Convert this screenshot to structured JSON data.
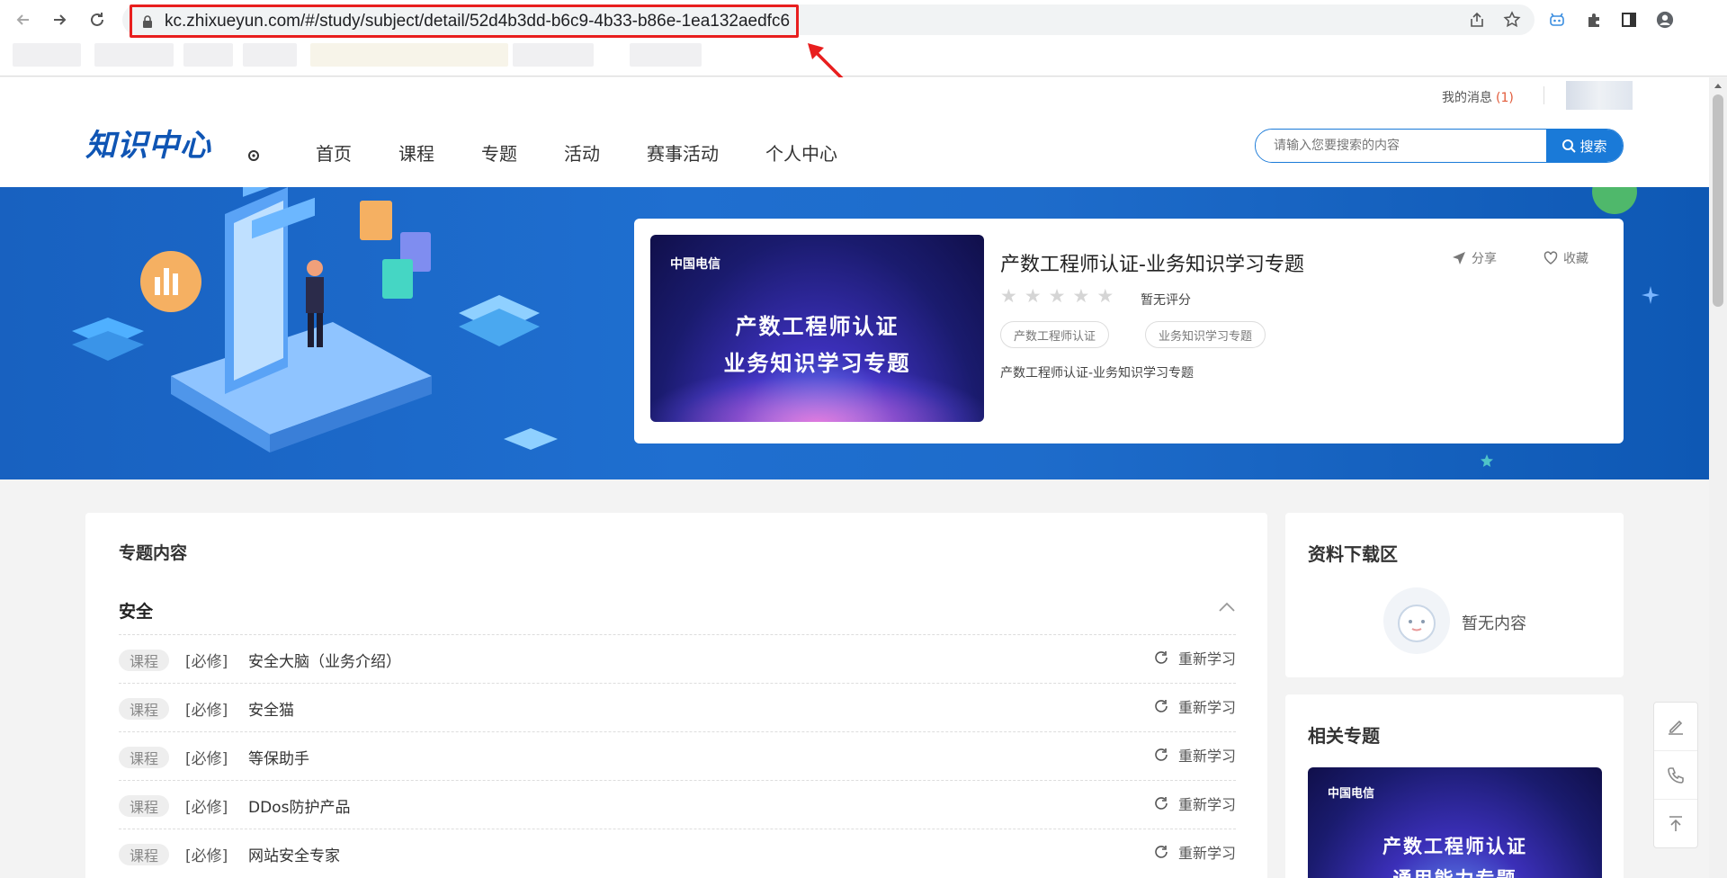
{
  "browser": {
    "url": "kc.zhixueyun.com/#/study/subject/detail/52d4b3dd-b6c9-4b33-b86e-1ea132aedfc6"
  },
  "header": {
    "messages_label": "我的消息",
    "messages_count": "(1)",
    "logo_text": "知识中心",
    "nav": [
      "首页",
      "课程",
      "专题",
      "活动",
      "赛事活动",
      "个人中心"
    ],
    "search_placeholder": "请输入您要搜索的内容",
    "search_button": "搜索"
  },
  "subject": {
    "cover_brand": "中国电信",
    "cover_line1": "产数工程师认证",
    "cover_line2": "业务知识学习专题",
    "title": "产数工程师认证-业务知识学习专题",
    "share_label": "分享",
    "favorite_label": "收藏",
    "rating_value": 0,
    "rating_max": 5,
    "rating_text": "暂无评分",
    "tags": [
      "产数工程师认证",
      "业务知识学习专题"
    ],
    "description": "产数工程师认证-业务知识学习专题"
  },
  "content": {
    "title": "专题内容",
    "section": "安全",
    "rows": [
      {
        "type": "课程",
        "required": "[必修]",
        "name": "安全大脑（业务介绍）",
        "action": "重新学习"
      },
      {
        "type": "课程",
        "required": "[必修]",
        "name": "安全猫",
        "action": "重新学习"
      },
      {
        "type": "课程",
        "required": "[必修]",
        "name": "等保助手",
        "action": "重新学习"
      },
      {
        "type": "课程",
        "required": "[必修]",
        "name": "DDos防护产品",
        "action": "重新学习"
      },
      {
        "type": "课程",
        "required": "[必修]",
        "name": "网站安全专家",
        "action": "重新学习"
      }
    ]
  },
  "sidebar": {
    "downloads_title": "资料下载区",
    "downloads_empty": "暂无内容",
    "related_title": "相关专题",
    "related_brand": "中国电信",
    "related_line1": "产数工程师认证",
    "related_line2": "通用能力专题"
  },
  "colors": {
    "accent": "#1a7ad8",
    "banner": "#1e6ccb",
    "highlight": "#e81e1e"
  }
}
